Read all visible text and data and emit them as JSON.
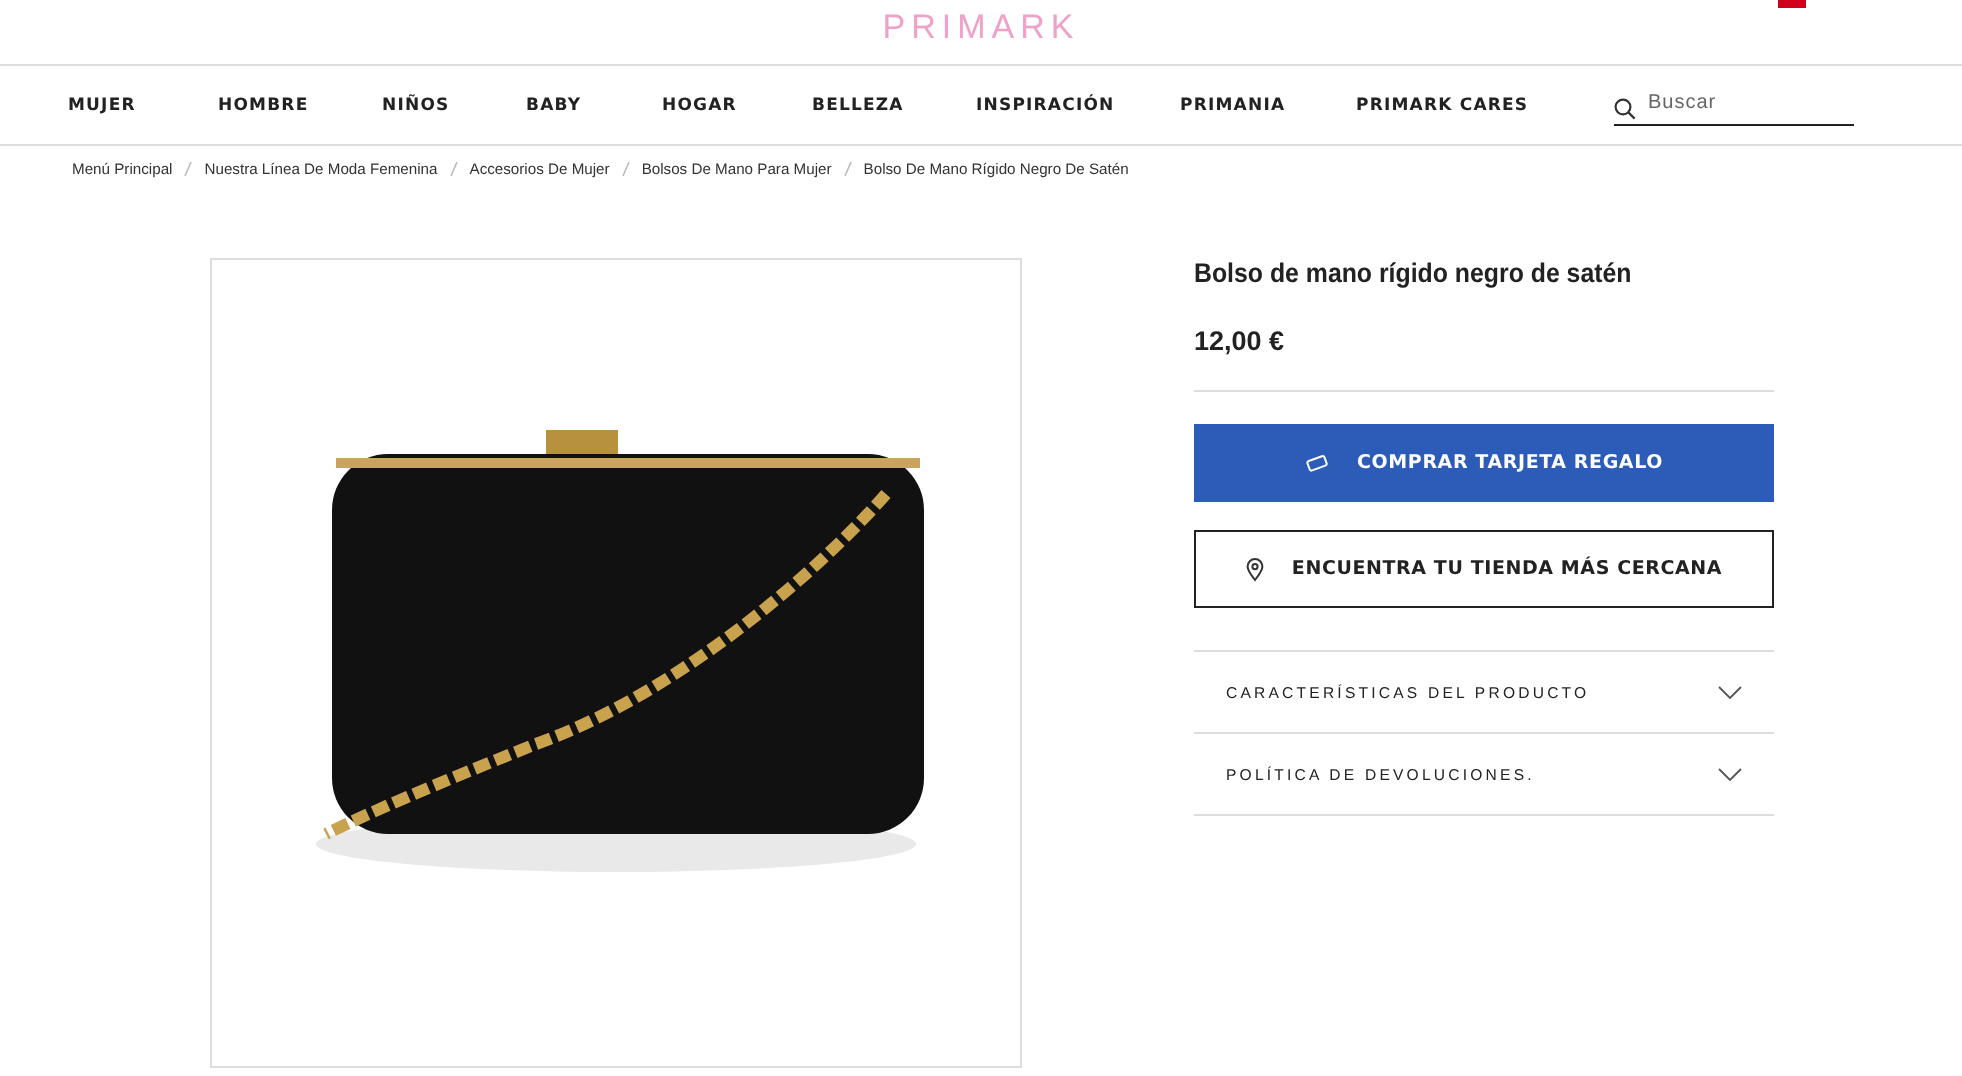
{
  "header": {
    "logo": "PRIMARK"
  },
  "nav": {
    "items": [
      {
        "label": "MUJER"
      },
      {
        "label": "HOMBRE"
      },
      {
        "label": "NIÑOS"
      },
      {
        "label": "BABY"
      },
      {
        "label": "HOGAR"
      },
      {
        "label": "BELLEZA"
      },
      {
        "label": "INSPIRACIÓN"
      },
      {
        "label": "PRIMANIA"
      },
      {
        "label": "PRIMARK CARES"
      }
    ],
    "search": {
      "placeholder": "Buscar"
    }
  },
  "breadcrumb": [
    "Menú Principal",
    "Nuestra Línea De Moda Femenina",
    "Accesorios De Mujer",
    "Bolsos De Mano Para Mujer",
    "Bolso De Mano Rígido Negro De Satén"
  ],
  "product": {
    "title": "Bolso de mano rígido negro de satén",
    "price": "12,00 €",
    "buttons": [
      {
        "kind": "primary",
        "label": "COMPRAR TARJETA REGALO"
      },
      {
        "kind": "outline",
        "label": "ENCUENTRA TU TIENDA MÁS CERCANA"
      }
    ],
    "sections": [
      {
        "label": "CARACTERÍSTICAS DEL PRODUCTO",
        "expanded": false
      },
      {
        "label": "POLÍTICA DE DEVOLUCIONES.",
        "expanded": false
      }
    ]
  }
}
